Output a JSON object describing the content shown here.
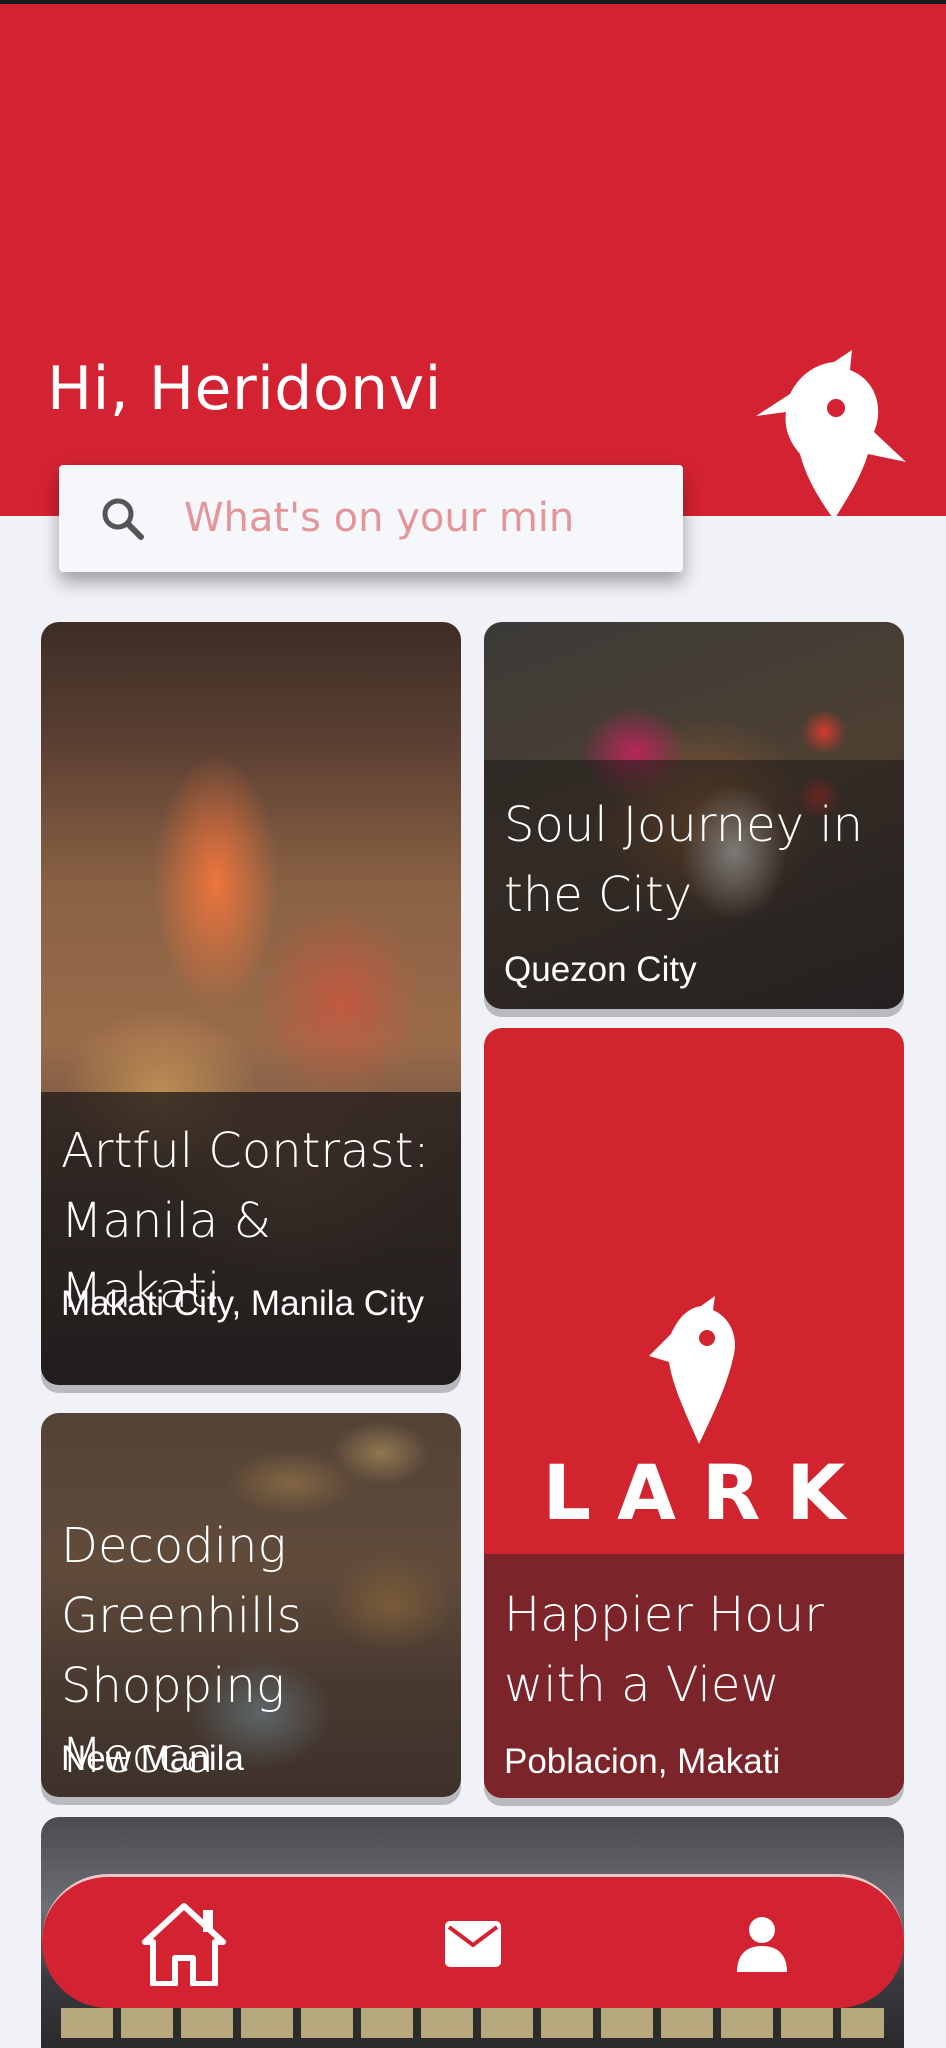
{
  "header": {
    "greeting": "Hi, Heridonvi",
    "logo_icon": "lark-bird-pin-icon"
  },
  "search": {
    "placeholder": "What's on your min",
    "icon": "search-icon"
  },
  "cards": [
    {
      "title": "Artful Contrast: Manila & Makati",
      "location": "Makati City, Manila City"
    },
    {
      "title": "Soul Journey in the City",
      "location": "Quezon City"
    },
    {
      "title": "Happier Hour with a View",
      "location": "Poblacion, Makati",
      "brand": "LARK"
    },
    {
      "title": "Decoding Greenhills Shopping Mecca",
      "location": "New Manila"
    }
  ],
  "nav": {
    "items": [
      {
        "icon": "home-icon"
      },
      {
        "icon": "mail-icon"
      },
      {
        "icon": "profile-icon"
      }
    ]
  },
  "colors": {
    "brand_red": "#d32231",
    "dark_red": "#7b252b",
    "background": "#f1f2f7"
  }
}
